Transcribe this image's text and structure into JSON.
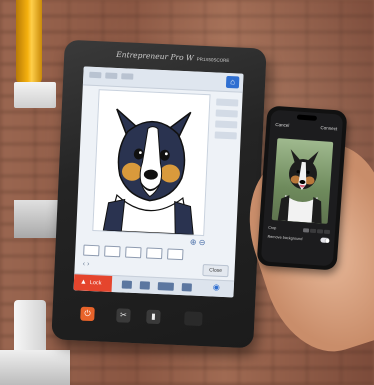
{
  "tablet": {
    "brand": "Entrepreneur Pro W",
    "brand_suffix": "PR1X50SCORE",
    "screen": {
      "lock_label": "Lock",
      "close_label": "Close",
      "zoom_label": "⊕ ⊖",
      "nav_arrows": "‹ ›"
    }
  },
  "phone": {
    "cancel_label": "Cancel",
    "connect_label": "Connect",
    "crop_label": "Crop",
    "remove_bg_label": "Remove background"
  },
  "colors": {
    "tablet_accent": "#e5452d",
    "tablet_home": "#2f6fd1",
    "spool": "#f5b10f"
  }
}
